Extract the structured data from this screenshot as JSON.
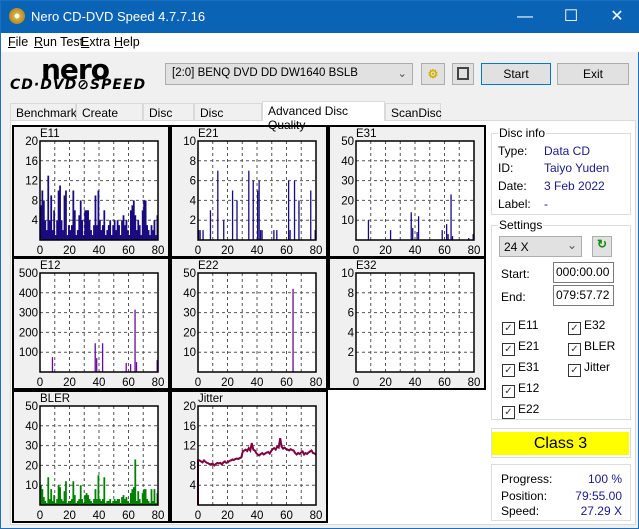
{
  "window": {
    "title": "Nero CD-DVD Speed 4.7.7.16",
    "minimize": "—",
    "maximize": "☐",
    "close": "✕"
  },
  "menu": [
    {
      "label": "File",
      "u": "F",
      "rest": "ile"
    },
    {
      "label": "Run Test",
      "u": "R",
      "rest": "un Test"
    },
    {
      "label": "Extra",
      "u": "E",
      "rest": "xtra"
    },
    {
      "label": "Help",
      "u": "H",
      "rest": "elp"
    }
  ],
  "logo": {
    "line1": "nero",
    "line2": "CD·DVD⊘SPEED"
  },
  "toolbar": {
    "drive": "[2:0]   BENQ DVD DD DW1640 BSLB",
    "start": "Start",
    "exit": "Exit",
    "eject_icon": "eject-icon",
    "save_icon": "floppy-disk-icon"
  },
  "tabs": [
    "Benchmark",
    "Create Disc",
    "Disc Info",
    "Disc Quality",
    "Advanced Disc Quality",
    "ScanDisc"
  ],
  "active_tab": "Advanced Disc Quality",
  "disc_info": {
    "title": "Disc info",
    "type_label": "Type:",
    "type": "Data CD",
    "id_label": "ID:",
    "id": "Taiyo Yuden",
    "date_label": "Date:",
    "date": "3 Feb 2022",
    "label_label": "Label:",
    "label": "-"
  },
  "settings": {
    "title": "Settings",
    "speed": "24 X",
    "start_label": "Start:",
    "start": "000:00.00",
    "end_label": "End:",
    "end": "079:57.72",
    "checks": [
      {
        "label": "E11",
        "checked": true
      },
      {
        "label": "E21",
        "checked": true
      },
      {
        "label": "E31",
        "checked": true
      },
      {
        "label": "E12",
        "checked": true
      },
      {
        "label": "E22",
        "checked": true
      },
      {
        "label": "E32",
        "checked": true
      },
      {
        "label": "BLER",
        "checked": true
      },
      {
        "label": "Jitter",
        "checked": true
      }
    ]
  },
  "class": {
    "label": "Class 3",
    "color": "#ffff00"
  },
  "status": {
    "progress_label": "Progress:",
    "progress": "100 %",
    "position_label": "Position:",
    "position": "79:55.00",
    "speed_label": "Speed:",
    "speed": "27.29 X"
  },
  "chart_data": [
    {
      "title": "E11",
      "type": "bar",
      "color": "#1a0a80",
      "ylim": [
        0,
        20
      ],
      "yticks": [
        4,
        8,
        12,
        16,
        20
      ],
      "xlim": [
        0,
        80
      ],
      "xticks": [
        0,
        20,
        40,
        60,
        80
      ],
      "values": [
        7,
        10,
        8,
        4,
        2,
        13,
        4,
        9,
        2,
        6,
        1,
        4,
        10,
        11,
        4,
        2,
        9,
        10,
        1,
        3,
        2,
        3,
        10,
        6,
        1,
        2,
        5,
        8,
        4,
        1,
        6,
        6,
        6,
        4,
        2,
        1,
        3,
        9,
        3,
        10,
        4,
        2,
        3,
        6,
        1,
        2,
        3,
        4,
        1,
        3,
        4,
        2,
        4,
        3,
        1,
        4,
        5,
        3,
        4,
        2,
        1,
        6,
        7,
        8,
        5,
        2,
        4,
        3,
        1,
        6,
        8,
        8,
        3,
        2,
        1,
        3,
        2,
        4,
        1,
        5
      ]
    },
    {
      "title": "E21",
      "type": "bar",
      "color": "#1a0a80",
      "ylim": [
        0,
        10
      ],
      "yticks": [
        2,
        4,
        6,
        8,
        10
      ],
      "xlim": [
        0,
        80
      ],
      "xticks": [
        0,
        20,
        40,
        60,
        80
      ],
      "points": [
        [
          0,
          1
        ],
        [
          1,
          1
        ],
        [
          3,
          1
        ],
        [
          8,
          3
        ],
        [
          13,
          7
        ],
        [
          17,
          2
        ],
        [
          23,
          5
        ],
        [
          26,
          4
        ],
        [
          34,
          7
        ],
        [
          37,
          6
        ],
        [
          40,
          5
        ],
        [
          41,
          6
        ],
        [
          42,
          1
        ],
        [
          43,
          1
        ],
        [
          51,
          1
        ],
        [
          53,
          1
        ],
        [
          61,
          6
        ],
        [
          62,
          1
        ],
        [
          65,
          6
        ],
        [
          68,
          4
        ],
        [
          76,
          5
        ],
        [
          79,
          1
        ]
      ]
    },
    {
      "title": "E31",
      "type": "bar",
      "color": "#1a0a80",
      "ylim": [
        0,
        50
      ],
      "yticks": [
        10,
        20,
        30,
        40,
        50
      ],
      "xlim": [
        0,
        80
      ],
      "xticks": [
        0,
        20,
        40,
        60,
        80
      ],
      "points": [
        [
          8,
          10
        ],
        [
          23,
          5
        ],
        [
          37,
          14
        ],
        [
          38,
          6
        ],
        [
          41,
          4
        ],
        [
          42,
          12
        ],
        [
          58,
          5
        ],
        [
          61,
          8
        ],
        [
          62,
          3
        ],
        [
          64,
          23
        ],
        [
          65,
          2
        ],
        [
          76,
          1
        ],
        [
          79,
          3
        ]
      ]
    },
    {
      "title": "E12",
      "type": "bar",
      "color": "#660a99",
      "ylim": [
        0,
        500
      ],
      "yticks": [
        100,
        200,
        300,
        400,
        500
      ],
      "xlim": [
        0,
        80
      ],
      "xticks": [
        0,
        20,
        40,
        60,
        80
      ],
      "points": [
        [
          8,
          75
        ],
        [
          24,
          5
        ],
        [
          37,
          145
        ],
        [
          38,
          70
        ],
        [
          40,
          5
        ],
        [
          42,
          145
        ],
        [
          58,
          45
        ],
        [
          61,
          40
        ],
        [
          64,
          315
        ],
        [
          65,
          50
        ],
        [
          79,
          60
        ]
      ]
    },
    {
      "title": "E22",
      "type": "bar",
      "color": "#660a99",
      "ylim": [
        0,
        50
      ],
      "yticks": [
        10,
        20,
        30,
        40,
        50
      ],
      "xlim": [
        0,
        80
      ],
      "xticks": [
        0,
        20,
        40,
        60,
        80
      ],
      "points": [
        [
          64,
          42
        ]
      ]
    },
    {
      "title": "E32",
      "type": "bar",
      "color": "#660a99",
      "ylim": [
        0,
        10
      ],
      "yticks": [
        2,
        4,
        6,
        8,
        10
      ],
      "xlim": [
        0,
        80
      ],
      "xticks": [
        0,
        20,
        40,
        60,
        80
      ],
      "points": []
    },
    {
      "title": "BLER",
      "type": "bar",
      "color": "#008000",
      "ylim": [
        0,
        50
      ],
      "yticks": [
        10,
        20,
        30,
        40,
        50
      ],
      "xlim": [
        0,
        80
      ],
      "xticks": [
        0,
        20,
        40,
        60,
        80
      ],
      "values": [
        10,
        8,
        4,
        2,
        1,
        14,
        3,
        8,
        2,
        5,
        1,
        3,
        10,
        9,
        3,
        2,
        7,
        12,
        1,
        2,
        2,
        3,
        12,
        5,
        1,
        2,
        3,
        10,
        3,
        1,
        5,
        6,
        5,
        3,
        2,
        1,
        3,
        8,
        3,
        15,
        3,
        2,
        3,
        14,
        1,
        2,
        2,
        3,
        1,
        2,
        3,
        2,
        3,
        3,
        1,
        4,
        5,
        3,
        4,
        2,
        1,
        6,
        8,
        9,
        23,
        2,
        7,
        3,
        1,
        6,
        8,
        8,
        3,
        2,
        1,
        8,
        2,
        8,
        1,
        6
      ]
    },
    {
      "title": "Jitter",
      "type": "line",
      "color": "#800040",
      "ylim": [
        0,
        20
      ],
      "yticks": [
        4,
        8,
        12,
        16,
        20
      ],
      "xlim": [
        0,
        80
      ],
      "xticks": [
        0,
        20,
        40,
        60,
        80
      ],
      "values": [
        9,
        9,
        8.8,
        8.6,
        9,
        8.7,
        8.5,
        8.4,
        8.2,
        8.3,
        8.3,
        8.0,
        8.3,
        8.5,
        8.4,
        8.5,
        8.2,
        8.6,
        8.8,
        8.5,
        8.6,
        8.9,
        9,
        9.2,
        9.1,
        9.3,
        9.4,
        9.3,
        9.5,
        9.6,
        10.8,
        11,
        11.2,
        10.9,
        11.5,
        11,
        12.5,
        11.2,
        11,
        10.5,
        10.2,
        10,
        10.3,
        10.5,
        10.2,
        10.4,
        10.6,
        10.7,
        10.4,
        10.9,
        11.3,
        11.5,
        11.2,
        11.8,
        11.6,
        13.5,
        11.8,
        11.4,
        11.6,
        11.3,
        11.2,
        11,
        11.3,
        11.1,
        11,
        10.5,
        10.2,
        10.5,
        10.3,
        10.6,
        10.8,
        10.2,
        10.5,
        10.3,
        10.6,
        10.8,
        11,
        10.5,
        10.4,
        10.2
      ]
    }
  ]
}
